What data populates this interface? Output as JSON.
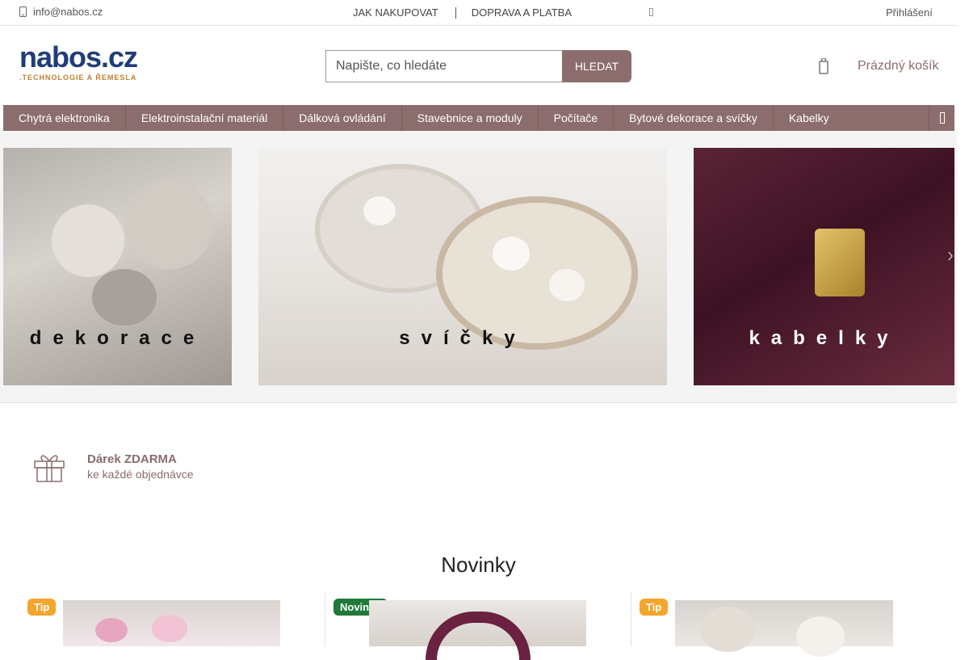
{
  "topbar": {
    "email": "info@nabos.cz",
    "links": [
      "JAK NAKUPOVAT",
      "DOPRAVA A PLATBA"
    ],
    "login": "Přihlášení"
  },
  "header": {
    "logo_word": "nabos.cz",
    "logo_tagline": ".TECHNOLOGIE A ŘEMESLA",
    "search_placeholder": "Napište, co hledáte",
    "search_button": "HLEDAT",
    "cart_label": "Prázdný košík"
  },
  "nav": {
    "items": [
      "Chytrá elektronika",
      "Elektroinstalační materiál",
      "Dálková ovládání",
      "Stavebnice a moduly",
      "Počítače",
      "Bytové dekorace a svíčky",
      "Kabelky"
    ]
  },
  "banners": [
    {
      "caption": "dekorace"
    },
    {
      "caption": "svíčky"
    },
    {
      "caption": "kabelky"
    }
  ],
  "benefit": {
    "title": "Dárek ZDARMA",
    "subtitle": "ke každé objednávce"
  },
  "section": {
    "title": "Novinky"
  },
  "products": [
    {
      "badge": "Tip"
    },
    {
      "badge": "Novinka"
    },
    {
      "badge": "Tip"
    }
  ],
  "colors": {
    "accent": "#8c6d6d",
    "badge_tip": "#f4a52c",
    "badge_new": "#1f7a3a"
  }
}
